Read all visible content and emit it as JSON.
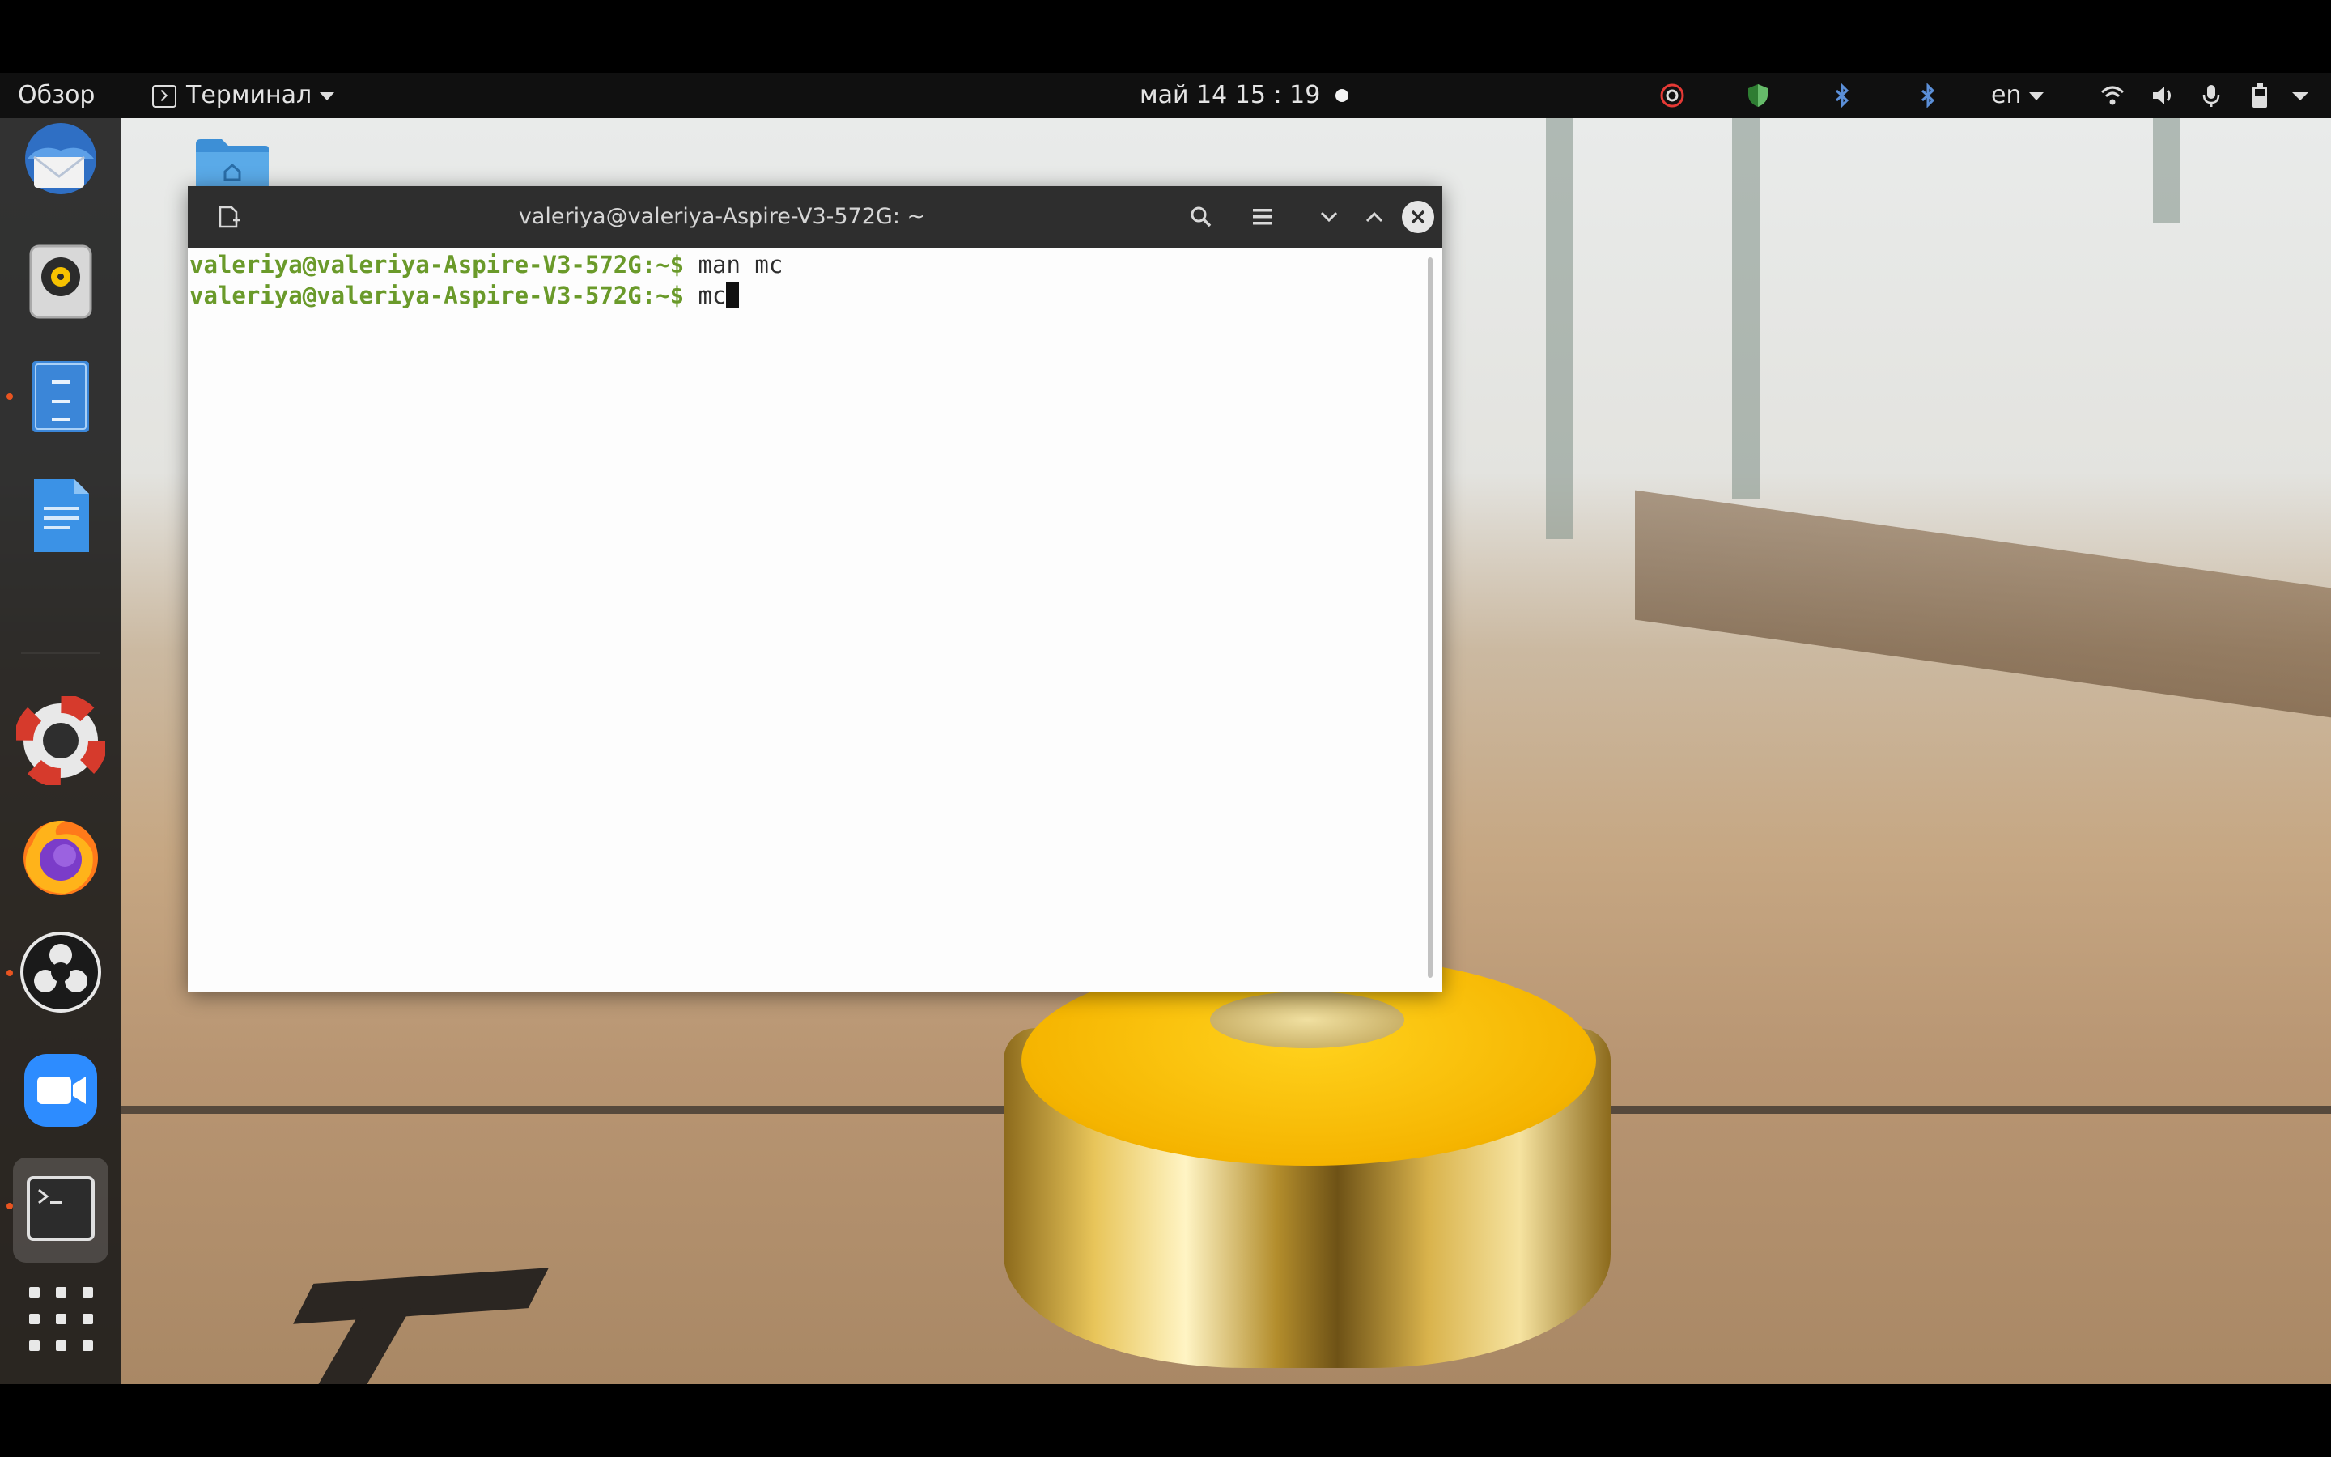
{
  "top_panel": {
    "activities": "Обзор",
    "app_menu": "Терминал",
    "clock": "май 14  15 : 19",
    "language": "en"
  },
  "tray_icons": [
    "screen-record-icon",
    "shield-icon",
    "bluetooth-icon",
    "bluetooth-icon",
    "wifi-icon",
    "volume-icon",
    "microphone-icon",
    "battery-icon",
    "system-menu-arrow-icon"
  ],
  "dock": {
    "items": [
      "thunderbird-icon",
      "rhythmbox-icon",
      "files-icon",
      "text-editor-icon",
      "help-icon",
      "firefox-icon",
      "obs-icon",
      "zoom-icon",
      "terminal-icon"
    ],
    "show_apps": "show-applications-icon"
  },
  "terminal": {
    "title": "valeriya@valeriya-Aspire-V3-572G: ~",
    "lines": [
      {
        "prompt": "valeriya@valeriya-Aspire-V3-572G:~$",
        "command": " man mc"
      },
      {
        "prompt": "valeriya@valeriya-Aspire-V3-572G:~$",
        "command": " mc"
      }
    ]
  },
  "colors": {
    "prompt": "#6a9a2a",
    "panel": "#101010",
    "accent_dot": "#e95420"
  }
}
